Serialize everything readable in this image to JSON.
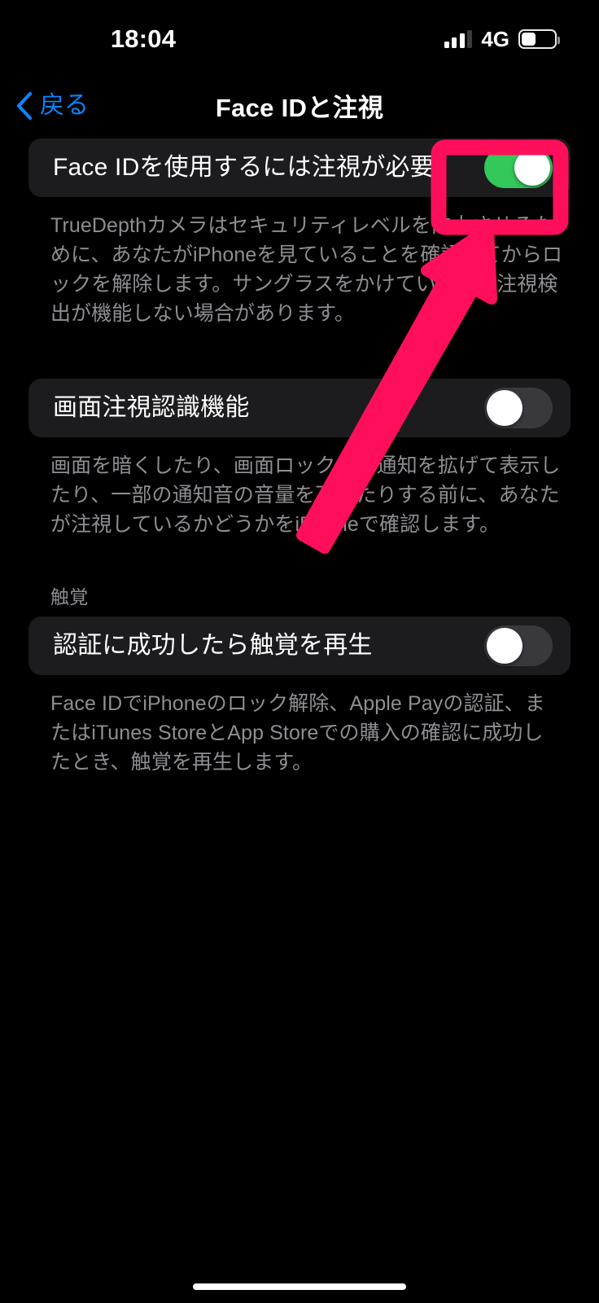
{
  "status_bar": {
    "time": "18:04",
    "network": "4G",
    "signal_icon": "cellular-signal-icon",
    "signal_bars_active": 3,
    "signal_bars_total": 4,
    "battery_icon": "battery-icon",
    "battery_level_percent": 40
  },
  "nav": {
    "back_label": "戻る",
    "back_icon": "chevron-left-icon",
    "title": "Face IDと注視",
    "back_color": "#0A84FF"
  },
  "sections": [
    {
      "rows": [
        {
          "label": "Face IDを使用するには注視が必要",
          "toggle_state": "on",
          "toggle_on_color": "#34C759"
        }
      ],
      "footer": "TrueDepthカメラはセキュリティレベルを向上させるために、あなたがiPhoneを見ていることを確認してからロックを解除します。サングラスをかけていると、注視検出が機能しない場合があります。"
    },
    {
      "rows": [
        {
          "label": "画面注視認識機能",
          "toggle_state": "off",
          "toggle_off_color": "#39393D"
        }
      ],
      "footer": "画面を暗くしたり、画面ロック中に通知を拡げて表示したり、一部の通知音の音量を下げたりする前に、あなたが注視しているかどうかをiPhoneで確認します。"
    },
    {
      "header": "触覚",
      "rows": [
        {
          "label": "認証に成功したら触覚を再生",
          "toggle_state": "off",
          "toggle_off_color": "#39393D"
        }
      ],
      "footer": "Face IDでiPhoneのロック解除、Apple Payの認証、またはiTunes StoreとApp Storeでの購入の確認に成功したとき、触覚を再生します。"
    }
  ],
  "annotation": {
    "highlight_color": "#FF0F5B",
    "highlight_target": "Face IDを使用するには注視が必要 のトグル",
    "arrow_color": "#FF0F5B"
  },
  "system": {
    "home_indicator": "home-indicator"
  }
}
